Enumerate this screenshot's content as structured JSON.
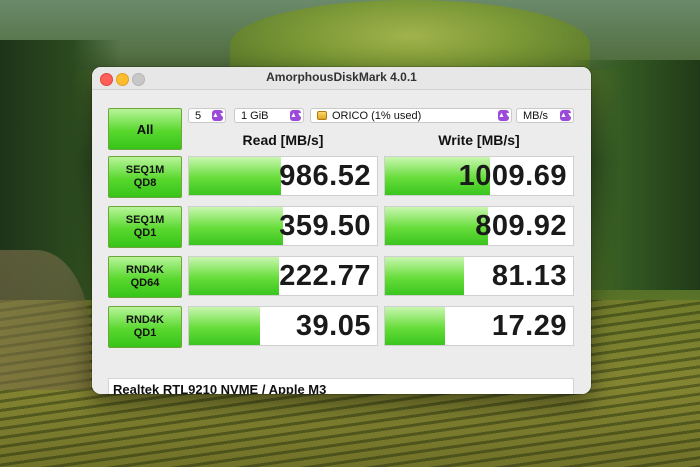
{
  "window": {
    "title": "AmorphousDiskMark 4.0.1"
  },
  "controls": {
    "all_label": "All",
    "count": "5",
    "size": "1 GiB",
    "drive": "ORICO (1% used)",
    "unit": "MB/s"
  },
  "headers": {
    "read": "Read [MB/s]",
    "write": "Write [MB/s]"
  },
  "tests": [
    {
      "line1": "SEQ1M",
      "line2": "QD8",
      "read": "986.52",
      "read_fill": 0.49,
      "write": "1009.69",
      "write_fill": 0.56
    },
    {
      "line1": "SEQ1M",
      "line2": "QD1",
      "read": "359.50",
      "read_fill": 0.5,
      "write": "809.92",
      "write_fill": 0.55
    },
    {
      "line1": "RND4K",
      "line2": "QD64",
      "read": "222.77",
      "read_fill": 0.48,
      "write": "81.13",
      "write_fill": 0.42
    },
    {
      "line1": "RND4K",
      "line2": "QD1",
      "read": "39.05",
      "read_fill": 0.38,
      "write": "17.29",
      "write_fill": 0.32
    }
  ],
  "footer": {
    "text": "Realtek RTL9210 NVME / Apple M3"
  },
  "colors": {
    "green": "#59d82e",
    "accent": "#9b4ad9"
  },
  "icons": {
    "drive": "drive-icon",
    "select": "updown-chevron-icon"
  }
}
